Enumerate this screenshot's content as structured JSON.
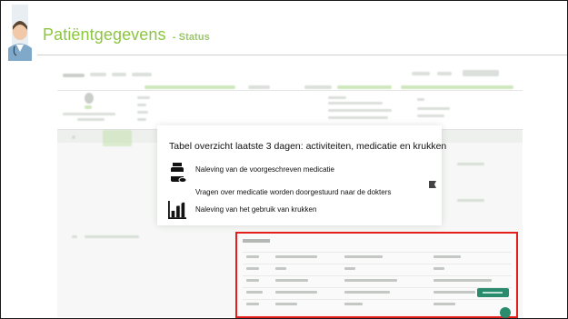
{
  "header": {
    "title": "Patiëntgegevens",
    "subtitle": "- Status"
  },
  "callout": {
    "heading": "Tabel overzicht laatste 3 dagen: activiteiten, medicatie en krukken",
    "items": [
      {
        "icon": "medication-bottle-icon",
        "label": "Naleving van de voorgeschreven medicatie"
      },
      {
        "icon": "send-icon",
        "label": "Vragen over medicatie worden doorgestuurd naar de dokters"
      },
      {
        "icon": "bar-chart-icon",
        "label": "Naleving van het gebruik van krukken"
      }
    ]
  },
  "colors": {
    "title": "#8cc63f",
    "highlight_border": "#e41d1d",
    "accent_button": "#2a8b6d"
  }
}
